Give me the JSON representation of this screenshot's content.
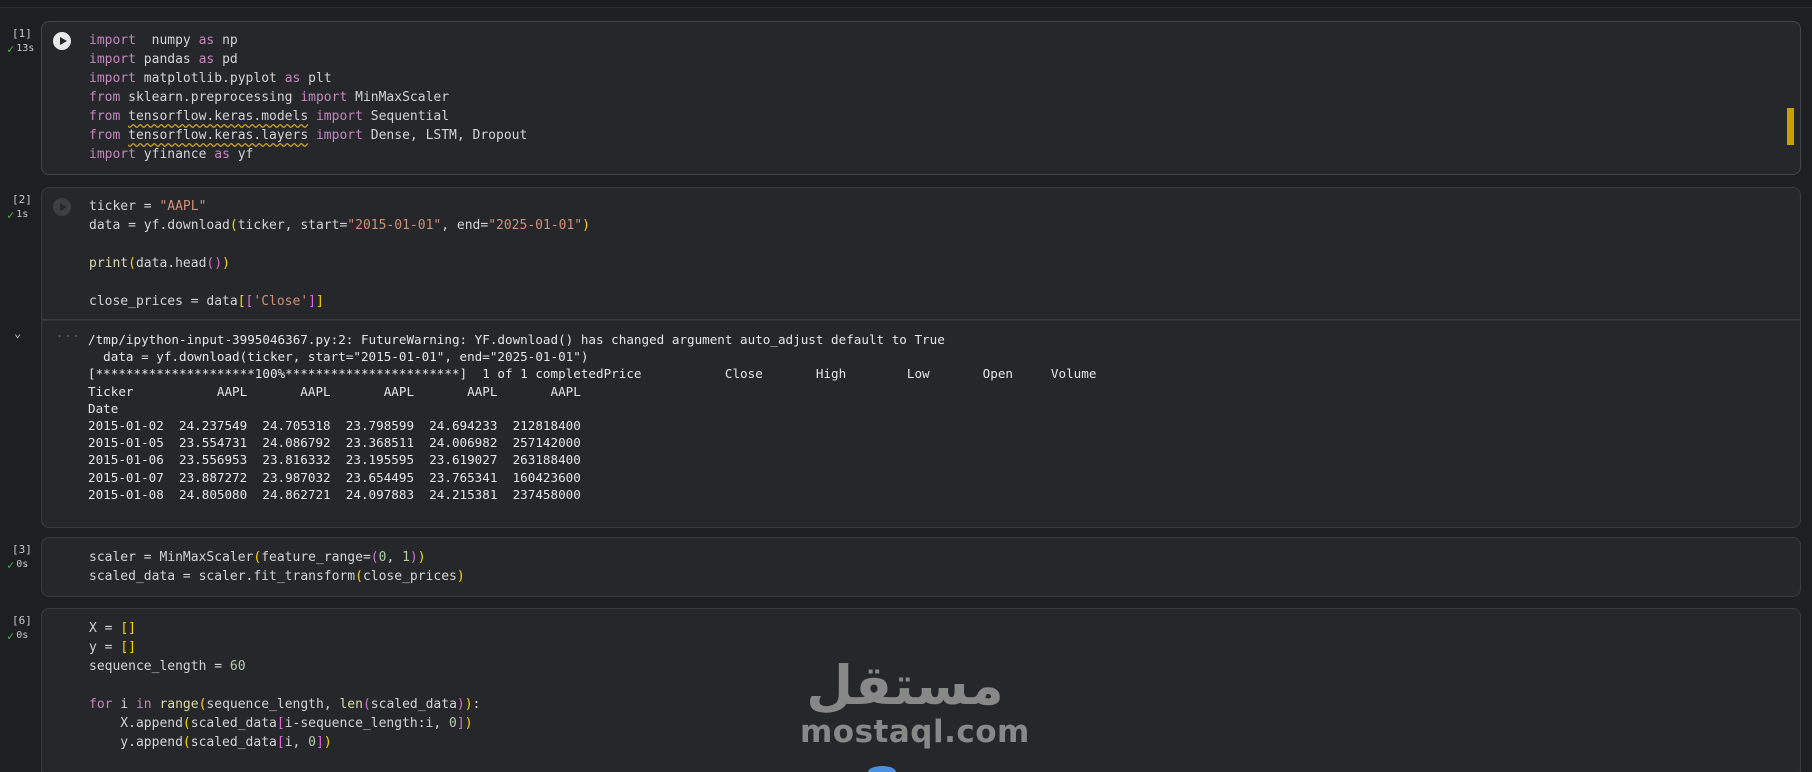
{
  "cells": [
    {
      "count": "[1]",
      "time": "13s",
      "lines": [
        [
          [
            "kw",
            "import"
          ],
          [
            "",
            "  numpy "
          ],
          [
            "kw",
            "as"
          ],
          [
            "",
            " np"
          ]
        ],
        [
          [
            "kw",
            "import"
          ],
          [
            "",
            " pandas "
          ],
          [
            "kw",
            "as"
          ],
          [
            "",
            " pd"
          ]
        ],
        [
          [
            "kw",
            "import"
          ],
          [
            "",
            " matplotlib.pyplot "
          ],
          [
            "kw",
            "as"
          ],
          [
            "",
            " plt"
          ]
        ],
        [
          [
            "kw",
            "from"
          ],
          [
            "",
            " sklearn.preprocessing "
          ],
          [
            "kw",
            "import"
          ],
          [
            "",
            " MinMaxScaler"
          ]
        ],
        [
          [
            "kw",
            "from"
          ],
          [
            "",
            " "
          ],
          [
            "squig",
            "tensorflow.keras.models"
          ],
          [
            "",
            " "
          ],
          [
            "kw",
            "import"
          ],
          [
            "",
            " Sequential"
          ]
        ],
        [
          [
            "kw",
            "from"
          ],
          [
            "",
            " "
          ],
          [
            "squig",
            "tensorflow.keras.layers"
          ],
          [
            "",
            " "
          ],
          [
            "kw",
            "import"
          ],
          [
            "",
            " Dense, LSTM, Dropout"
          ]
        ],
        [
          [
            "kw",
            "import"
          ],
          [
            "",
            " yfinance "
          ],
          [
            "kw",
            "as"
          ],
          [
            "",
            " yf"
          ]
        ]
      ]
    },
    {
      "count": "[2]",
      "time": "1s",
      "lines": [
        [
          [
            "",
            "ticker = "
          ],
          [
            "str",
            "\"AAPL\""
          ]
        ],
        [
          [
            "",
            "data = yf.download"
          ],
          [
            "br",
            "("
          ],
          [
            "",
            "ticker, start="
          ],
          [
            "str",
            "\"2015-01-01\""
          ],
          [
            "",
            ", end="
          ],
          [
            "str",
            "\"2025-01-01\""
          ],
          [
            "br",
            ")"
          ]
        ],
        [],
        [
          [
            "fn",
            "print"
          ],
          [
            "br",
            "("
          ],
          [
            "",
            "data.head"
          ],
          [
            "br2",
            "()"
          ],
          [
            "br",
            ")"
          ]
        ],
        [],
        [
          [
            "",
            "close_prices = data"
          ],
          [
            "br",
            "["
          ],
          [
            "br2",
            "["
          ],
          [
            "str",
            "'Close'"
          ],
          [
            "br2",
            "]"
          ],
          [
            "br",
            "]"
          ]
        ]
      ],
      "output": [
        "/tmp/ipython-input-3995046367.py:2: FutureWarning: YF.download() has changed argument auto_adjust default to True",
        "  data = yf.download(ticker, start=\"2015-01-01\", end=\"2025-01-01\")",
        "[*********************100%***********************]  1 of 1 completedPrice           Close       High        Low       Open     Volume",
        "Ticker           AAPL       AAPL       AAPL       AAPL       AAPL",
        "Date",
        "2015-01-02  24.237549  24.705318  23.798599  24.694233  212818400",
        "2015-01-05  23.554731  24.086792  23.368511  24.006982  257142000",
        "2015-01-06  23.556953  23.816332  23.195595  23.619027  263188400",
        "2015-01-07  23.887272  23.987032  23.654495  23.765341  160423600",
        "2015-01-08  24.805080  24.862721  24.097883  24.215381  237458000"
      ]
    },
    {
      "count": "[3]",
      "time": "0s",
      "lines": [
        [
          [
            "",
            "scaler = MinMaxScaler"
          ],
          [
            "br",
            "("
          ],
          [
            "",
            "feature_range="
          ],
          [
            "br2",
            "("
          ],
          [
            "num",
            "0"
          ],
          [
            "",
            ", "
          ],
          [
            "num",
            "1"
          ],
          [
            "br2",
            ")"
          ],
          [
            "br",
            ")"
          ]
        ],
        [
          [
            "",
            "scaled_data = scaler.fit_transform"
          ],
          [
            "br",
            "("
          ],
          [
            "",
            "close_prices"
          ],
          [
            "br",
            ")"
          ]
        ]
      ]
    },
    {
      "count": "[6]",
      "time": "0s",
      "lines": [
        [
          [
            "",
            "X = "
          ],
          [
            "br",
            "[]"
          ]
        ],
        [
          [
            "",
            "y = "
          ],
          [
            "br",
            "[]"
          ]
        ],
        [
          [
            "",
            "sequence_length = "
          ],
          [
            "num",
            "60"
          ]
        ],
        [],
        [
          [
            "kw",
            "for"
          ],
          [
            "",
            " i "
          ],
          [
            "kw",
            "in"
          ],
          [
            "",
            " "
          ],
          [
            "fn",
            "range"
          ],
          [
            "br",
            "("
          ],
          [
            "",
            "sequence_length, "
          ],
          [
            "fn",
            "len"
          ],
          [
            "br2",
            "("
          ],
          [
            "",
            "scaled_data"
          ],
          [
            "br2",
            ")"
          ],
          [
            "br",
            ")"
          ],
          [
            "",
            ":"
          ]
        ],
        [
          [
            "",
            "    X.append"
          ],
          [
            "br",
            "("
          ],
          [
            "",
            "scaled_data"
          ],
          [
            "br2",
            "["
          ],
          [
            "",
            "i-sequence_length:i, "
          ],
          [
            "num",
            "0"
          ],
          [
            "br2",
            "]"
          ],
          [
            "br",
            ")"
          ]
        ],
        [
          [
            "",
            "    y.append"
          ],
          [
            "br",
            "("
          ],
          [
            "",
            "scaled_data"
          ],
          [
            "br2",
            "["
          ],
          [
            "",
            "i, "
          ],
          [
            "num",
            "0"
          ],
          [
            "br2",
            "]"
          ],
          [
            "br",
            ")"
          ]
        ]
      ]
    }
  ],
  "output_menu": "...",
  "watermark": {
    "arabic": "مستقل",
    "latin": "mostaql.com"
  },
  "colors": {
    "background": "#1e1f22",
    "cell": "#26272b",
    "border": "#3a3b40",
    "success": "#4caf50",
    "scroll_thumb": "#c8a000"
  },
  "icons": {
    "run": "play-icon",
    "status": "check-icon",
    "collapse": "chevron-down-icon"
  }
}
